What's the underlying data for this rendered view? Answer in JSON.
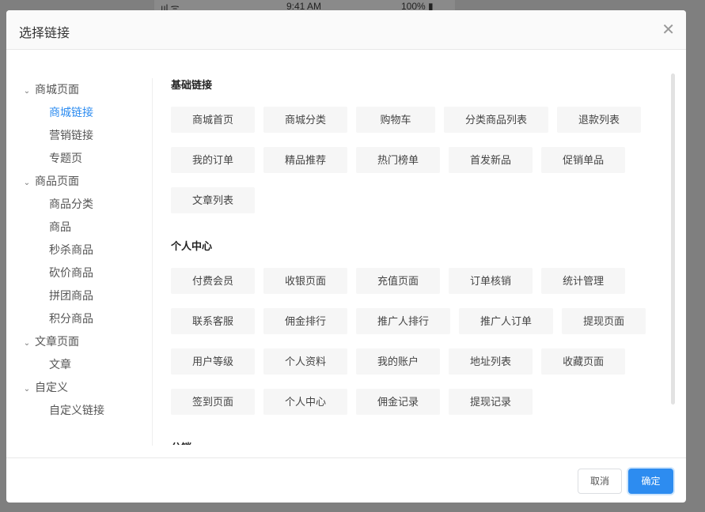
{
  "status_bar": {
    "signal": "ııl ᯤ",
    "time": "9:41 AM",
    "battery": "100% ▮"
  },
  "dialog": {
    "title": "选择链接",
    "close_icon": "close-icon"
  },
  "tree": [
    {
      "label": "商城页面",
      "children": [
        {
          "label": "商城链接",
          "active": true
        },
        {
          "label": "营销链接"
        },
        {
          "label": "专题页"
        }
      ]
    },
    {
      "label": "商品页面",
      "children": [
        {
          "label": "商品分类"
        },
        {
          "label": "商品"
        },
        {
          "label": "秒杀商品"
        },
        {
          "label": "砍价商品"
        },
        {
          "label": "拼团商品"
        },
        {
          "label": "积分商品"
        }
      ]
    },
    {
      "label": "文章页面",
      "children": [
        {
          "label": "文章"
        }
      ]
    },
    {
      "label": "自定义",
      "children": [
        {
          "label": "自定义链接"
        }
      ]
    }
  ],
  "sections": [
    {
      "title": "基础链接",
      "links": [
        "商城首页",
        "商城分类",
        "购物车",
        "分类商品列表",
        "退款列表",
        "我的订单",
        "精品推荐",
        "热门榜单",
        "首发新品",
        "促销单品",
        "文章列表"
      ]
    },
    {
      "title": "个人中心",
      "links": [
        "付费会员",
        "收银页面",
        "充值页面",
        "订单核销",
        "统计管理",
        "联系客服",
        "佣金排行",
        "推广人排行",
        "推广人订单",
        "提现页面",
        "用户等级",
        "个人资料",
        "我的账户",
        "地址列表",
        "收藏页面",
        "签到页面",
        "个人中心",
        "佣金记录",
        "提现记录"
      ]
    },
    {
      "title": "分销",
      "links": []
    }
  ],
  "footer": {
    "cancel": "取消",
    "ok": "确定"
  },
  "colors": {
    "accent": "#2d8cf0"
  }
}
